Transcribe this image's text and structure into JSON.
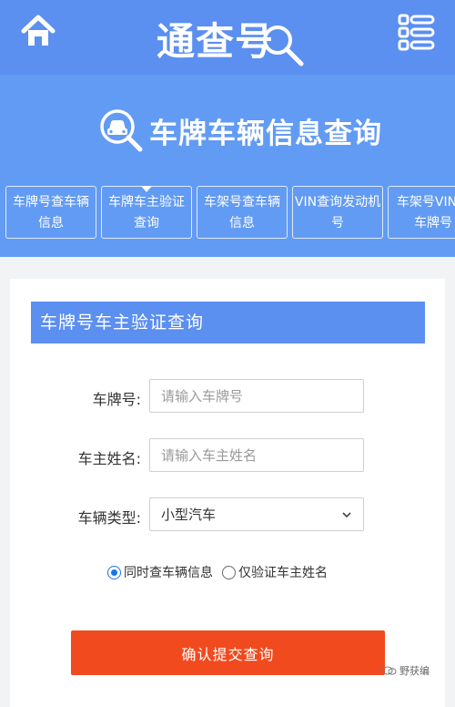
{
  "header": {
    "logo_text": "通查号"
  },
  "hero": {
    "title": "车牌车辆信息查询"
  },
  "tabs": [
    {
      "line1": "车牌号查车辆",
      "line2": "信息"
    },
    {
      "line1": "车牌车主验证",
      "line2": "查询",
      "active": true
    },
    {
      "line1": "车架号查车辆",
      "line2": "信息"
    },
    {
      "line1": "VIN查询发动机",
      "line2": "号"
    },
    {
      "line1": "车架号VIN查",
      "line2": "车牌号"
    }
  ],
  "form": {
    "title": "车牌号车主验证查询",
    "plate": {
      "label": "车牌号:",
      "placeholder": "请输入车牌号"
    },
    "owner": {
      "label": "车主姓名:",
      "placeholder": "请输入车主姓名"
    },
    "type": {
      "label": "车辆类型:",
      "value": "小型汽车"
    },
    "radio1": "同时查车辆信息",
    "radio2": "仅验证车主姓名",
    "submit": "确认提交查询"
  },
  "watermark": "野获编",
  "colors": {
    "header": "#5b8ff0",
    "hero": "#629bf3",
    "submit": "#f24a1f",
    "radio": "#1a73e8"
  },
  "icons": {
    "home": "home-icon",
    "menu": "menu-list-icon",
    "search": "magnifier-icon",
    "car": "car-search-icon"
  }
}
